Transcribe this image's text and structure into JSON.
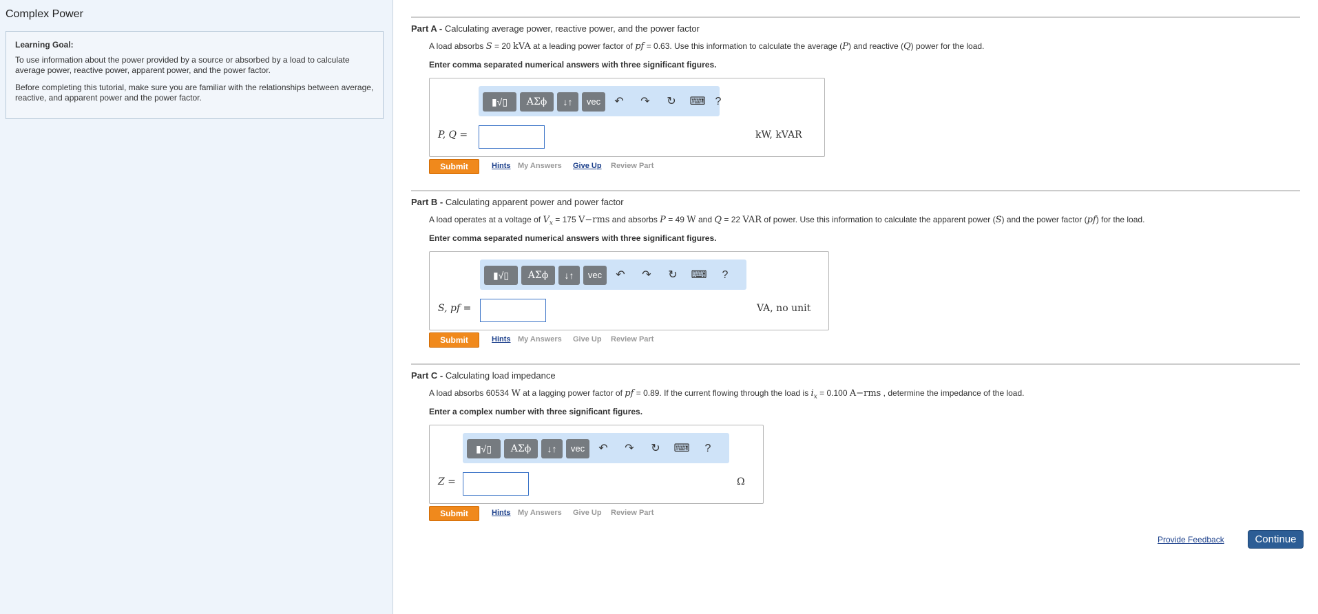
{
  "sidebar": {
    "title": "Complex Power",
    "goal_heading": "Learning Goal:",
    "goal_p1": "To use information about the power provided by a source or absorbed by a load to calculate average power, reactive power, apparent power, and the power factor.",
    "goal_p2": "Before completing this tutorial, make sure you are familiar with the relationships between average, reactive, and apparent power and the power factor."
  },
  "toolbar": {
    "templates": "▮√▯",
    "greek": "ΑΣϕ",
    "arrows": "↓↑",
    "vec": "vec",
    "undo": "↶",
    "redo": "↷",
    "reset": "↻",
    "keyboard": "⌨",
    "help": "?"
  },
  "actions": {
    "submit": "Submit",
    "hints": "Hints",
    "my_answers": "My Answers",
    "give_up": "Give Up",
    "review_part": "Review Part"
  },
  "parts": [
    {
      "label": "Part A - ",
      "title": "Calculating average power, reactive power, and the power factor",
      "q": [
        "A load absorbs ",
        "S",
        " = 20 ",
        "kVA",
        " at a leading power factor of ",
        "pf",
        " = 0.63. Use this information to calculate the average (",
        "P",
        ") and reactive (",
        "Q",
        ") power for the load."
      ],
      "instruction": "Enter comma separated numerical answers with three significant figures.",
      "answer_label": "P, Q",
      "eq": " =",
      "unit": "kW, kVAR",
      "input_value": ""
    },
    {
      "label": "Part B - ",
      "title": "Calculating apparent power and power factor",
      "q": [
        "A load operates at a voltage of ",
        "V",
        "x",
        " = 175 ",
        "V−rms",
        " and absorbs ",
        "P",
        " = 49 ",
        "W",
        " and ",
        "Q",
        " = 22 ",
        "VAR",
        " of power. Use this information to calculate the apparent power (",
        "S",
        ") and the power factor (",
        "pf",
        ") for the load."
      ],
      "instruction": "Enter comma separated numerical answers with three significant figures.",
      "answer_label": "S, pf",
      "eq": " =",
      "unit": "VA, no unit",
      "input_value": ""
    },
    {
      "label": "Part C - ",
      "title": "Calculating load impedance",
      "q": [
        "A load absorbs 60534 ",
        "W",
        "  at a lagging power factor of ",
        "pf",
        " = 0.89. If the current flowing through the load is ",
        "i",
        "x",
        " = 0.100 ",
        "A−rms",
        " , determine the impedance of the load."
      ],
      "instruction": "Enter a complex number with three significant figures.",
      "answer_label": "Z",
      "eq": " =",
      "unit": "Ω",
      "input_value": ""
    }
  ],
  "footer": {
    "feedback": "Provide Feedback",
    "continue": "Continue"
  }
}
